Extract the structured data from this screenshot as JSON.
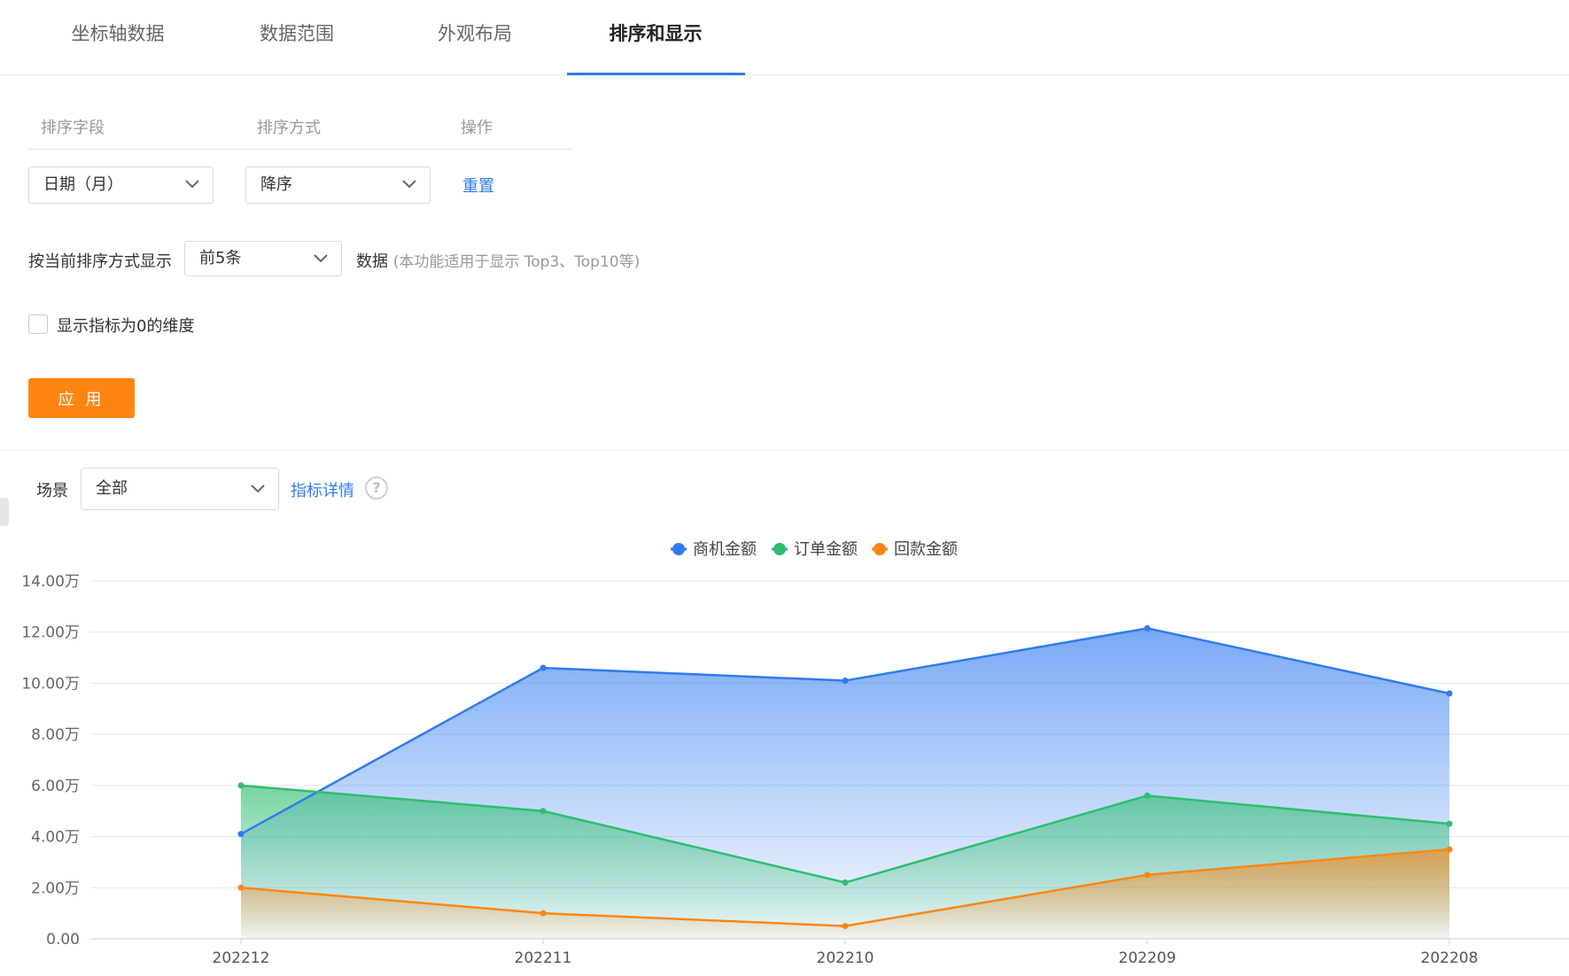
{
  "tabs": [
    {
      "label": "坐标轴数据",
      "active": false
    },
    {
      "label": "数据范围",
      "active": false
    },
    {
      "label": "外观布局",
      "active": false
    },
    {
      "label": "排序和显示",
      "active": true
    }
  ],
  "sort": {
    "headers": {
      "field": "排序字段",
      "method": "排序方式",
      "action": "操作"
    },
    "field_value": "日期（月）",
    "method_value": "降序",
    "reset_label": "重置"
  },
  "display": {
    "prefix": "按当前排序方式显示",
    "count_value": "前5条",
    "suffix": "数据",
    "hint": "(本功能适用于显示 Top3、Top10等)"
  },
  "checkbox": {
    "label": "显示指标为0的维度",
    "checked": false
  },
  "apply_label": "应 用",
  "scene": {
    "label": "场景",
    "value": "全部",
    "details_link": "指标详情",
    "help_glyph": "?"
  },
  "colors": {
    "accent": "#2f7bf0",
    "apply": "#ff8513",
    "series_blue": "#2f7bf0",
    "series_green": "#2ebd6e",
    "series_orange": "#ff8513"
  },
  "chart_data": {
    "type": "area",
    "categories": [
      "202212",
      "202211",
      "202210",
      "202209",
      "202208"
    ],
    "series": [
      {
        "name": "商机金额",
        "values": [
          4.1,
          10.6,
          10.1,
          12.15,
          9.6
        ],
        "color": "#2f7bf0"
      },
      {
        "name": "订单金额",
        "values": [
          6.0,
          5.0,
          2.2,
          5.6,
          4.5
        ],
        "color": "#2ebd6e"
      },
      {
        "name": "回款金额",
        "values": [
          2.0,
          1.0,
          0.5,
          2.5,
          3.5
        ],
        "color": "#ff8513"
      }
    ],
    "yticks": [
      "0.00",
      "2.00万",
      "4.00万",
      "6.00万",
      "8.00万",
      "10.00万",
      "12.00万",
      "14.00万"
    ],
    "ylim": [
      0,
      14
    ],
    "grid": true,
    "legend_position": "top-center"
  }
}
